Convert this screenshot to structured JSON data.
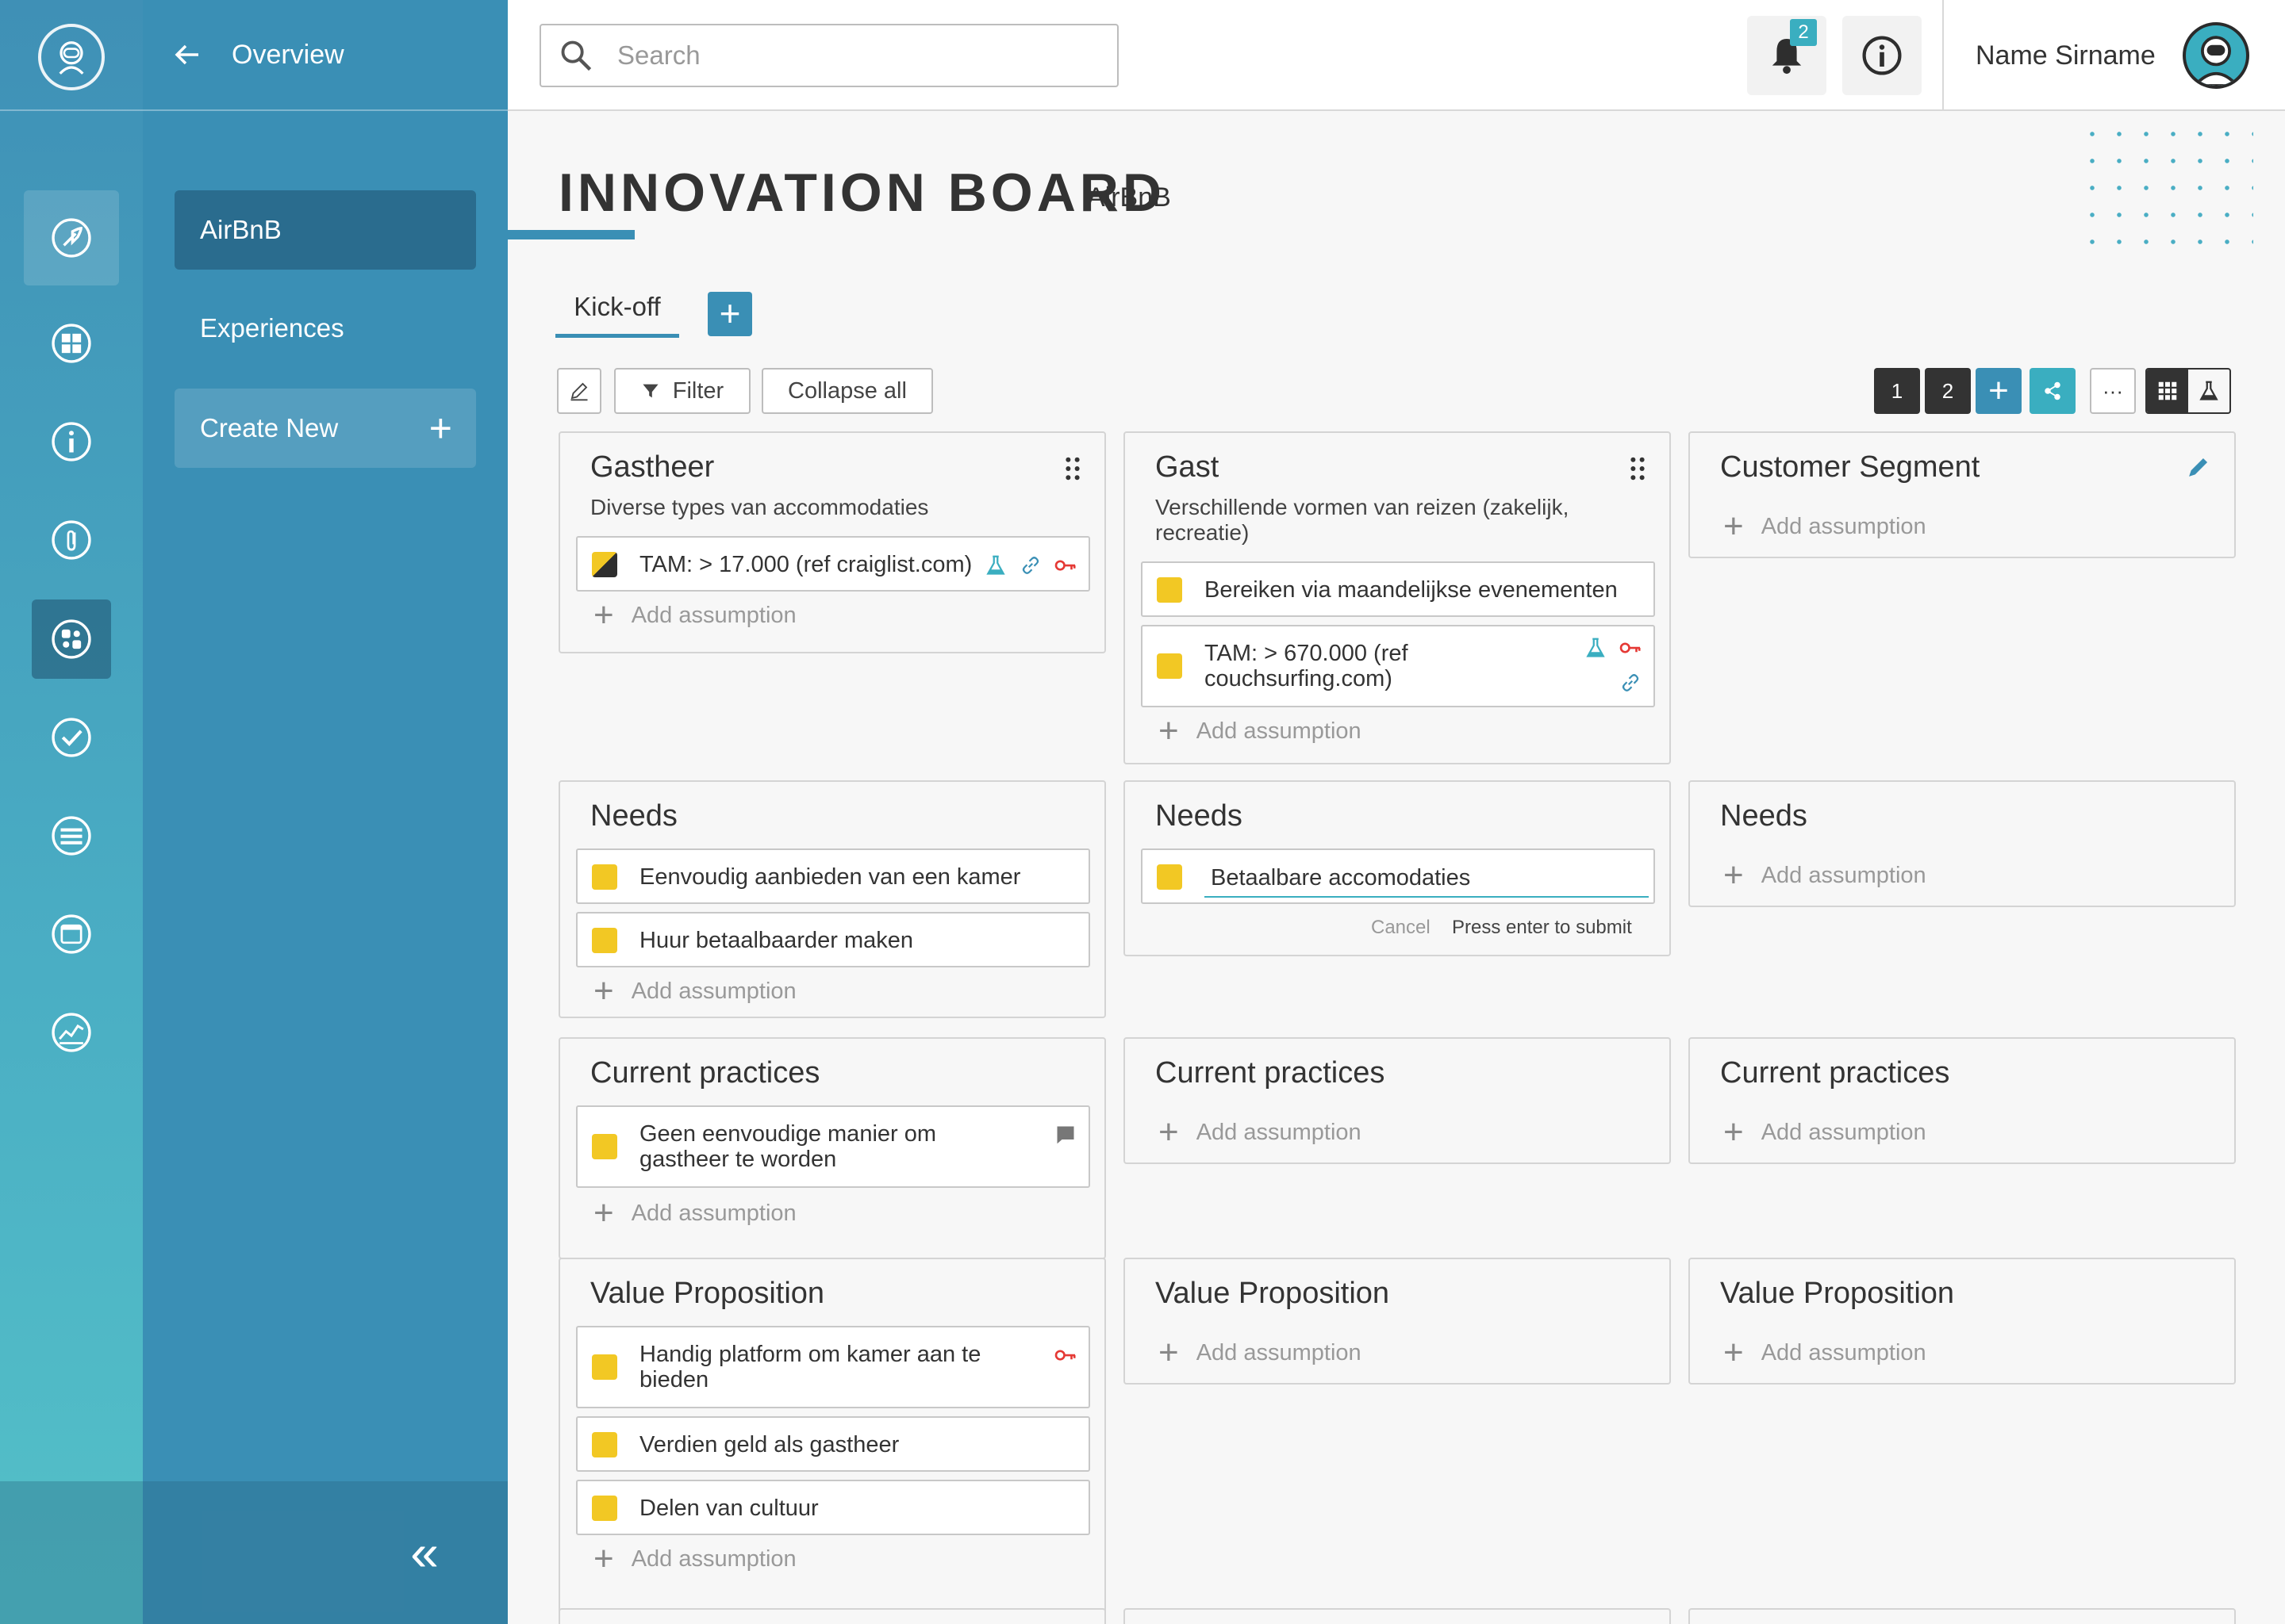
{
  "sidebar": {
    "items": [
      "rocket-icon",
      "puzzle-grid-icon",
      "info-icon",
      "paperclip-icon",
      "puzzle-icon",
      "check-icon",
      "list-icon",
      "calendar-icon",
      "chart-icon"
    ],
    "accent": "#3a8fb5"
  },
  "panel": {
    "back_label": "Overview",
    "items": [
      "AirBnB",
      "Experiences"
    ],
    "create_label": "Create New",
    "collapse_glyph": "«"
  },
  "topbar": {
    "search_placeholder": "Search",
    "notification_count": "2",
    "user_name": "Name Sirname"
  },
  "page": {
    "title": "INNOVATION BOARD",
    "subtitle": "AirBnB"
  },
  "tabs": [
    {
      "label": "Kick-off"
    }
  ],
  "toolbar": {
    "filter_label": "Filter",
    "collapse_label": "Collapse all",
    "page_1": "1",
    "page_2": "2",
    "more_label": "···"
  },
  "add_label": "Add assumption",
  "columns": [
    {
      "segment": {
        "title": "Gastheer",
        "description": "Diverse types van accommodaties",
        "assumptions": [
          "TAM: > 17.000 (ref craiglist.com)"
        ]
      },
      "needs": {
        "title": "Needs",
        "assumptions": [
          "Eenvoudig aanbieden van een kamer",
          "Huur betaalbaarder maken"
        ]
      },
      "practices": {
        "title": "Current practices",
        "assumptions": [
          "Geen eenvoudige manier om gastheer te worden"
        ]
      },
      "value": {
        "title": "Value Proposition",
        "assumptions": [
          "Handig platform om kamer aan te bieden",
          "Verdien geld als gastheer",
          "Delen van cultuur"
        ]
      }
    },
    {
      "segment": {
        "title": "Gast",
        "description": "Verschillende vormen van reizen (zakelijk, recreatie)",
        "assumptions": [
          "Bereiken via maandelijkse evenementen",
          "TAM: > 670.000 (ref couchsurfing.com)"
        ]
      },
      "needs": {
        "title": "Needs",
        "editing_value": "Betaalbare accomodaties",
        "cancel_label": "Cancel",
        "submit_hint": "Press enter to submit"
      },
      "practices": {
        "title": "Current practices"
      },
      "value": {
        "title": "Value Proposition"
      }
    },
    {
      "segment": {
        "title": "Customer Segment"
      },
      "needs": {
        "title": "Needs"
      },
      "practices": {
        "title": "Current practices"
      },
      "value": {
        "title": "Value Proposition"
      }
    }
  ]
}
